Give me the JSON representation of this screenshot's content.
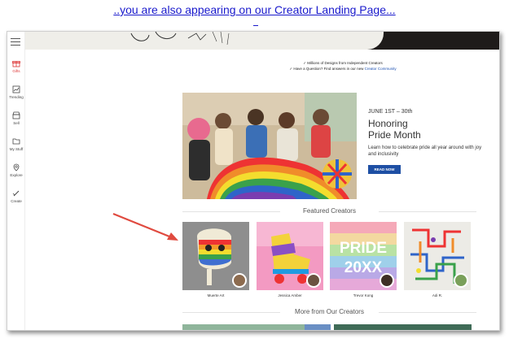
{
  "caption": {
    "prefix": "..you are also appearing on our ",
    "link": "Creator Landing Page",
    "suffix": "..."
  },
  "sidebar": {
    "items": [
      {
        "label": "Gifts",
        "icon": "gift-icon",
        "active": true
      },
      {
        "label": "Trending",
        "icon": "trending-icon"
      },
      {
        "label": "Sell",
        "icon": "store-icon"
      },
      {
        "label": "My Stuff",
        "icon": "folder-icon"
      },
      {
        "label": "Explore",
        "icon": "compass-icon"
      },
      {
        "label": "Create",
        "icon": "pencil-icon"
      }
    ]
  },
  "bullets": {
    "line1": "✓ Millions of Designs from Independent Creators",
    "line2_prefix": "✓ Have a Question? Find answers in our new ",
    "line2_link": "Creator Community"
  },
  "promo": {
    "date": "JUNE 1ST – 30th",
    "title_line1": "Honoring",
    "title_line2": "Pride Month",
    "description": "Learn how to celebrate pride all year around with joy and inclusivity",
    "button": "READ NOW"
  },
  "featured": {
    "heading": "Featured Creators",
    "creators": [
      {
        "name": "Muerte Art"
      },
      {
        "name": "Jessica Amber"
      },
      {
        "name": "Trevor Kong",
        "art_text_1": "PRIDE",
        "art_text_2": "20XX"
      },
      {
        "name": "Adi R."
      }
    ]
  },
  "more": {
    "heading": "More from Our Creators"
  },
  "colors": {
    "accent_blue": "#1e4fa4",
    "arrow_red": "#e04a3f",
    "link_blue": "#1a1acc"
  }
}
